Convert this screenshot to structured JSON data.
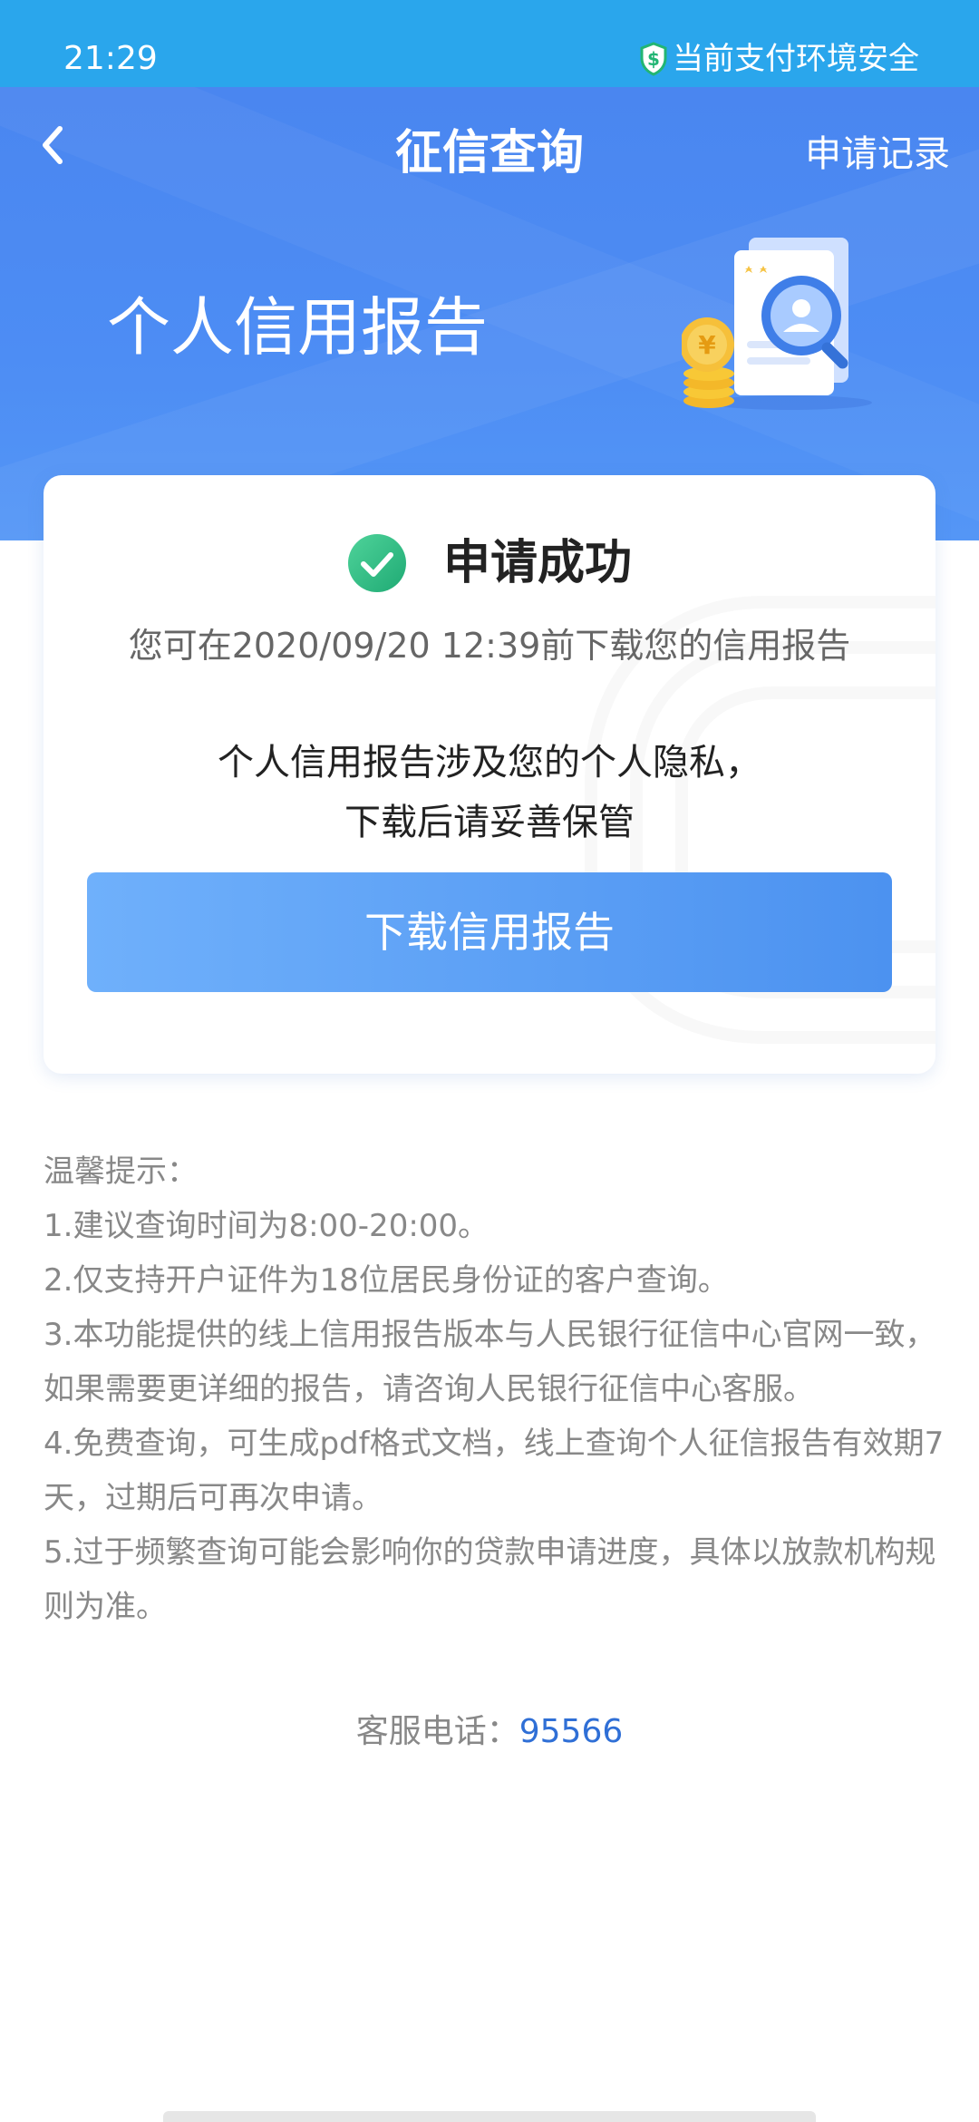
{
  "status_bar": {
    "time": "21:29",
    "security_text": "当前支付环境安全",
    "security_icon": "green-shield-dollar-icon"
  },
  "header": {
    "back_icon": "chevron-left-icon",
    "title": "征信查询",
    "records_link": "申请记录"
  },
  "hero": {
    "heading": "个人信用报告",
    "illustration": "document-magnifier-coin-illustration"
  },
  "card": {
    "success_icon": "green-check-circle-icon",
    "success_text": "申请成功",
    "deadline_text": "您可在2020/09/20 12:39前下载您的信用报告",
    "privacy_text": "个人信用报告涉及您的个人隐私，\n下载后请妥善保管",
    "download_button": "下载信用报告"
  },
  "tips": {
    "title": "温馨提示：",
    "items": [
      "1.建议查询时间为8:00-20:00。",
      "2.仅支持开户证件为18位居民身份证的客户查询。",
      "3.本功能提供的线上信用报告版本与人民银行征信中心官网一致，如果需要更详细的报告，请咨询人民银行征信中心客服。",
      "4.免费查询，可生成pdf格式文档，线上查询个人征信报告有效期7天，过期后可再次申请。",
      "5.过于频繁查询可能会影响你的贷款申请进度，具体以放款机构规则为准。"
    ]
  },
  "service": {
    "label": "客服电话：",
    "phone": "95566"
  },
  "colors": {
    "status_bar": "#2aa6ec",
    "hero": "#4a86f0",
    "button_start": "#6fb0fb",
    "button_end": "#4c92f0",
    "success_green": "#2fbf86",
    "link_blue": "#2f6fd6"
  }
}
